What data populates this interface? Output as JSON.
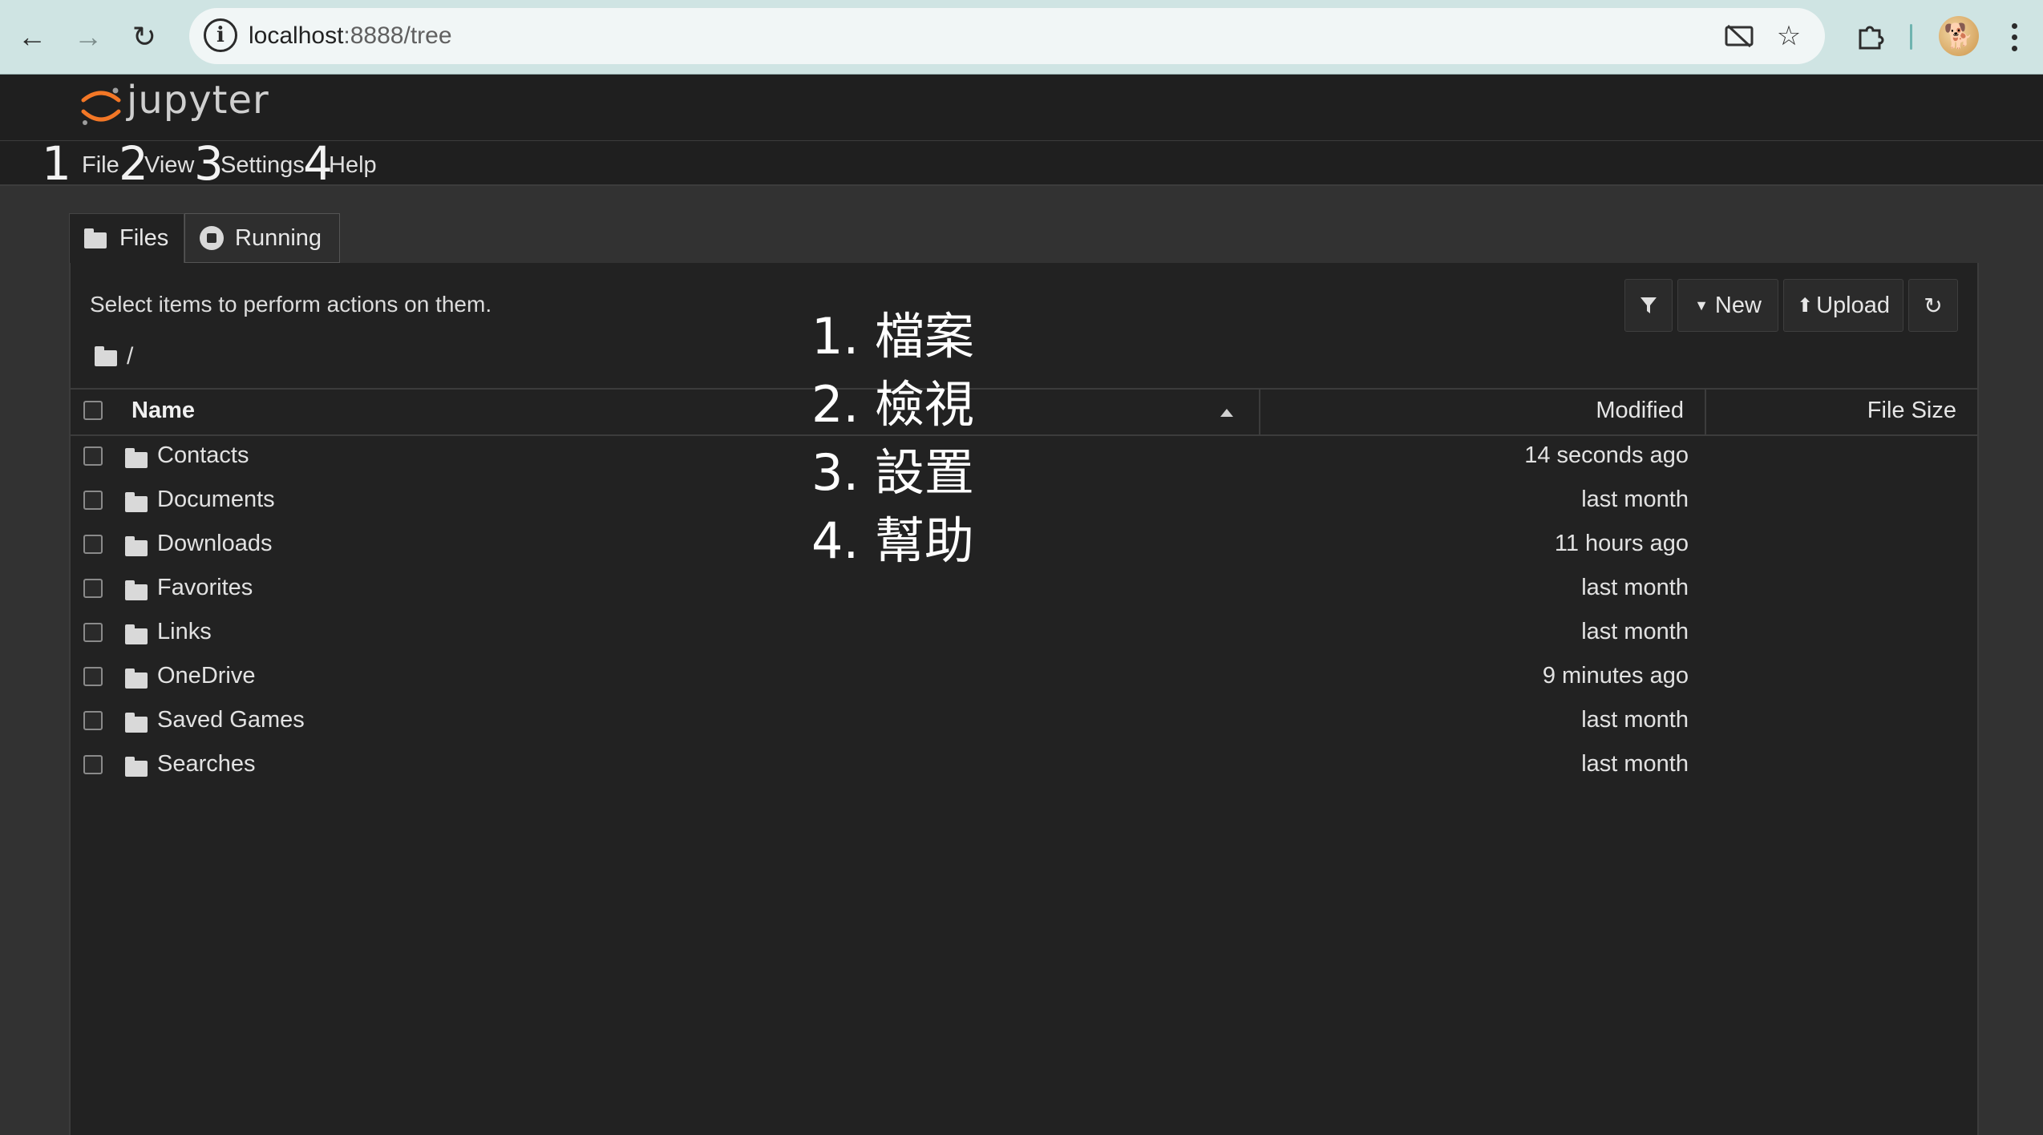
{
  "browser": {
    "url_host": "localhost",
    "url_path": ":8888/tree",
    "icons": [
      "back-arrow-icon",
      "forward-arrow-icon",
      "reload-icon",
      "site-info-icon",
      "cast-off-icon",
      "bookmark-star-icon",
      "extensions-puzzle-icon",
      "profile-avatar-icon",
      "more-menu-icon"
    ]
  },
  "app": {
    "wordmark": "jupyter",
    "brand_color": "#f37726"
  },
  "menu": {
    "items": [
      {
        "num": "1",
        "label": "File"
      },
      {
        "num": "2",
        "label": "View"
      },
      {
        "num": "3",
        "label": "Settings"
      },
      {
        "num": "4",
        "label": "Help"
      }
    ]
  },
  "tabs": [
    {
      "label": "Files",
      "icon": "folder-icon"
    },
    {
      "label": "Running",
      "icon": "running-stop-icon"
    }
  ],
  "browser_panel": {
    "hint": "Select items to perform actions on them.",
    "breadcrumb": "/",
    "toolbar": {
      "filter_icon": "filter-icon",
      "new_label": "New",
      "upload_label": "Upload",
      "refresh_icon": "refresh-icon"
    },
    "columns": {
      "name": "Name",
      "modified": "Modified",
      "size": "File Size"
    },
    "files": [
      {
        "name": "Contacts",
        "modified": "14 seconds ago"
      },
      {
        "name": "Documents",
        "modified": "last month"
      },
      {
        "name": "Downloads",
        "modified": "11 hours ago"
      },
      {
        "name": "Favorites",
        "modified": "last month"
      },
      {
        "name": "Links",
        "modified": "last month"
      },
      {
        "name": "OneDrive",
        "modified": "9 minutes ago"
      },
      {
        "name": "Saved Games",
        "modified": "last month"
      },
      {
        "name": "Searches",
        "modified": "last month"
      }
    ]
  },
  "overlay": {
    "items": [
      "1. 檔案",
      "2. 檢視",
      "3. 設置",
      "4. 幫助"
    ]
  }
}
